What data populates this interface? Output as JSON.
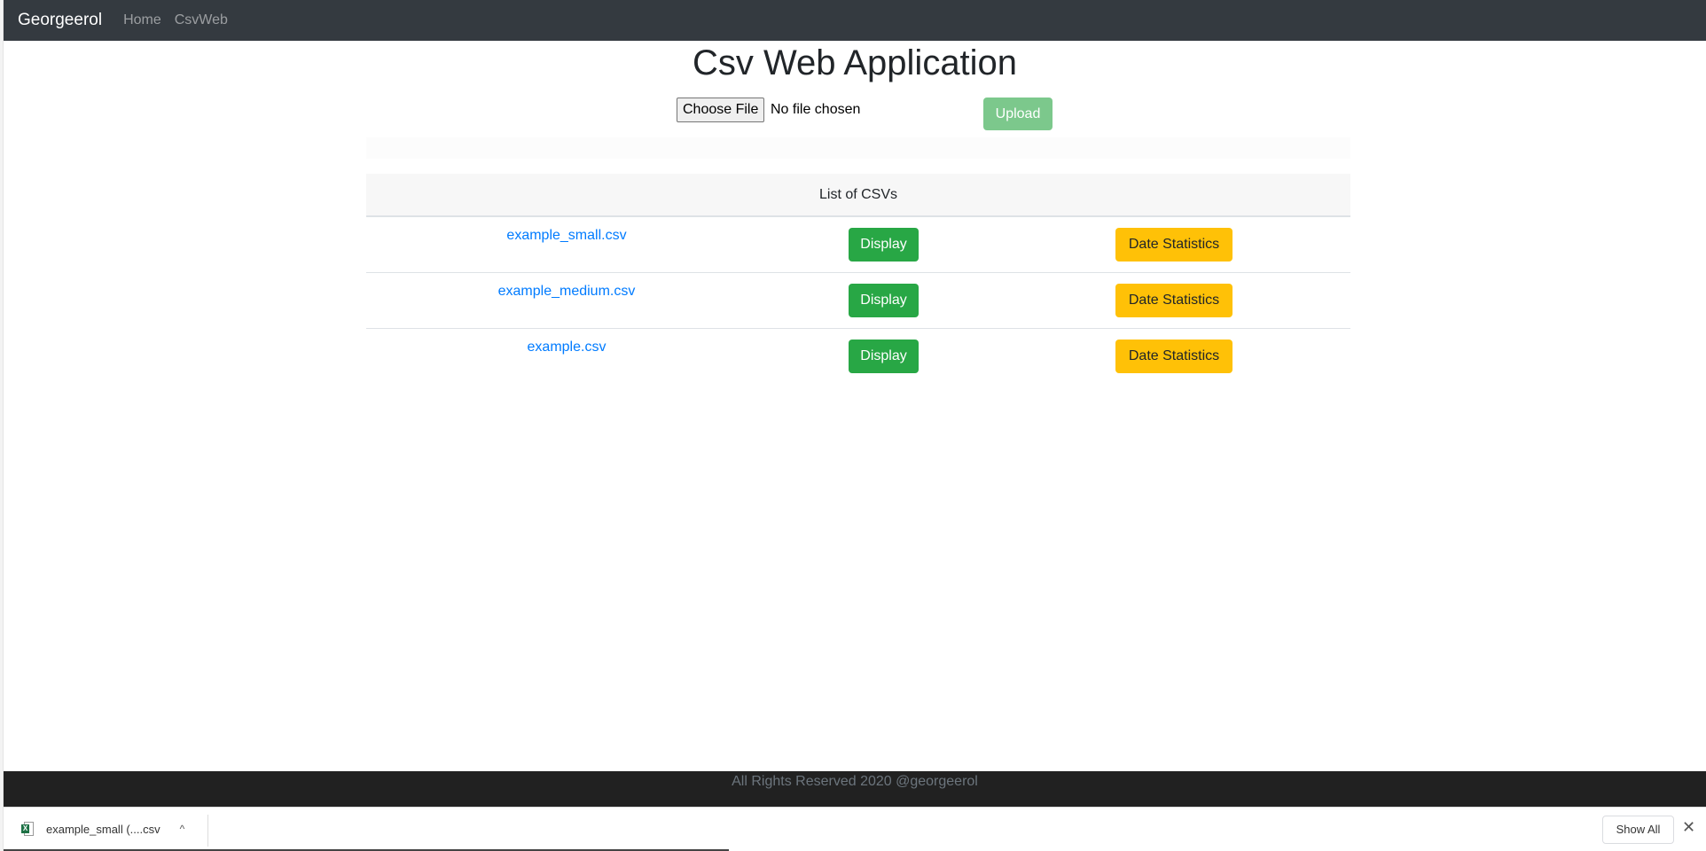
{
  "navbar": {
    "brand": "Georgeerol",
    "links": [
      "Home",
      "CsvWeb"
    ]
  },
  "page": {
    "title": "Csv Web Application"
  },
  "upload": {
    "choose_file_label": "Choose File",
    "file_status": "No file chosen",
    "upload_label": "Upload"
  },
  "table": {
    "header": "List of CSVs",
    "rows": [
      {
        "file": "example_small.csv",
        "display_label": "Display",
        "date_label": "Date Statistics"
      },
      {
        "file": "example_medium.csv",
        "display_label": "Display",
        "date_label": "Date Statistics"
      },
      {
        "file": "example.csv",
        "display_label": "Display",
        "date_label": "Date Statistics"
      }
    ]
  },
  "footer": {
    "text": "All Rights Reserved 2020 @georgeerol"
  },
  "download_bar": {
    "file_name": "example_small (....csv",
    "file_icon": "excel-file-icon",
    "chevron_icon": "chevron-up-icon",
    "show_all_label": "Show All",
    "close_icon": "close-icon",
    "chevron_glyph": "^",
    "close_glyph": "✕"
  },
  "colors": {
    "navbar_bg": "#343a40",
    "link": "#007bff",
    "display_btn": "#28a745",
    "date_btn": "#ffc107",
    "upload_btn_disabled": "#7cc88c",
    "footer_bg": "#212121"
  }
}
